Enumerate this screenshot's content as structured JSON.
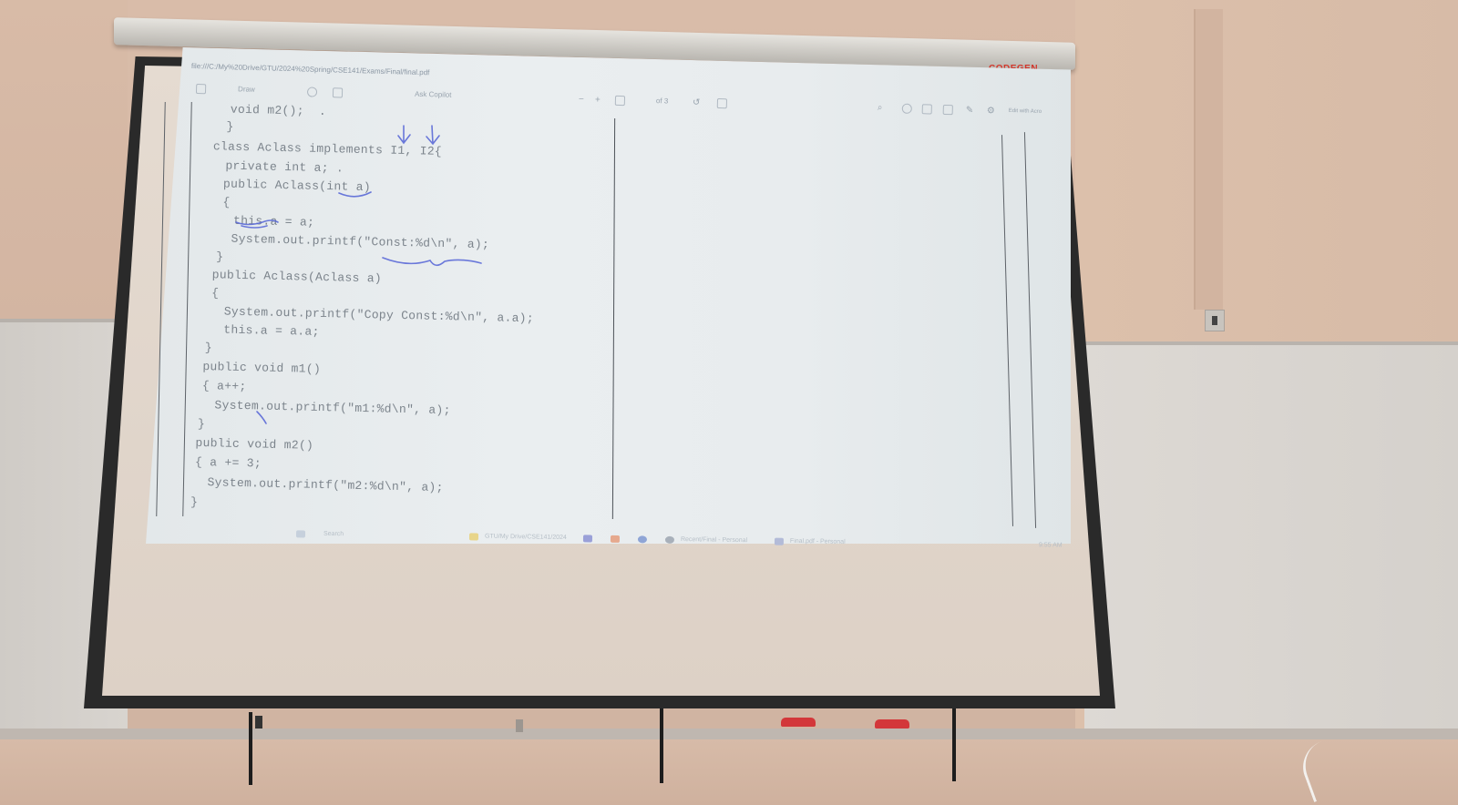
{
  "projector": {
    "brand": "CODEGEN",
    "address_bar": "file:///C:/My%20Drive/GTU/2024%20Spring/CSE141/Exams/Final/final.pdf",
    "toolbar": {
      "draw_label": "Draw",
      "copilot_label": "Ask Copilot",
      "page_label": "of 3",
      "edit_label": "Edit with Acro"
    }
  },
  "code_lines": [
    "void m2();  .",
    "}",
    "class Aclass implements I1, I2{",
    "private int a; .",
    "public Aclass(int a)",
    "{",
    "this.a = a;",
    "System.out.printf(\"Const:%d\\n\", a);",
    "}",
    "public Aclass(Aclass a)",
    "{",
    "System.out.printf(\"Copy Const:%d\\n\", a.a);",
    "this.a = a.a;",
    "}",
    "public void m1()",
    "{ a++;",
    "System.out.printf(\"m1:%d\\n\", a);",
    "}",
    "public void m2()",
    "{ a += 3;",
    "System.out.printf(\"m2:%d\\n\", a);",
    "}"
  ],
  "taskbar": {
    "search": "Search",
    "folder": "GTU/My Drive/CSE141/2024",
    "app1": "Recent/Final - Personal",
    "app2": "Final.pdf - Personal",
    "clock": "9:55 AM"
  },
  "colors": {
    "ink": "#4a5ad0",
    "screen_frame": "#2a2a2a",
    "mount_bracket": "#d3373a",
    "code_text": "#7c848c"
  }
}
